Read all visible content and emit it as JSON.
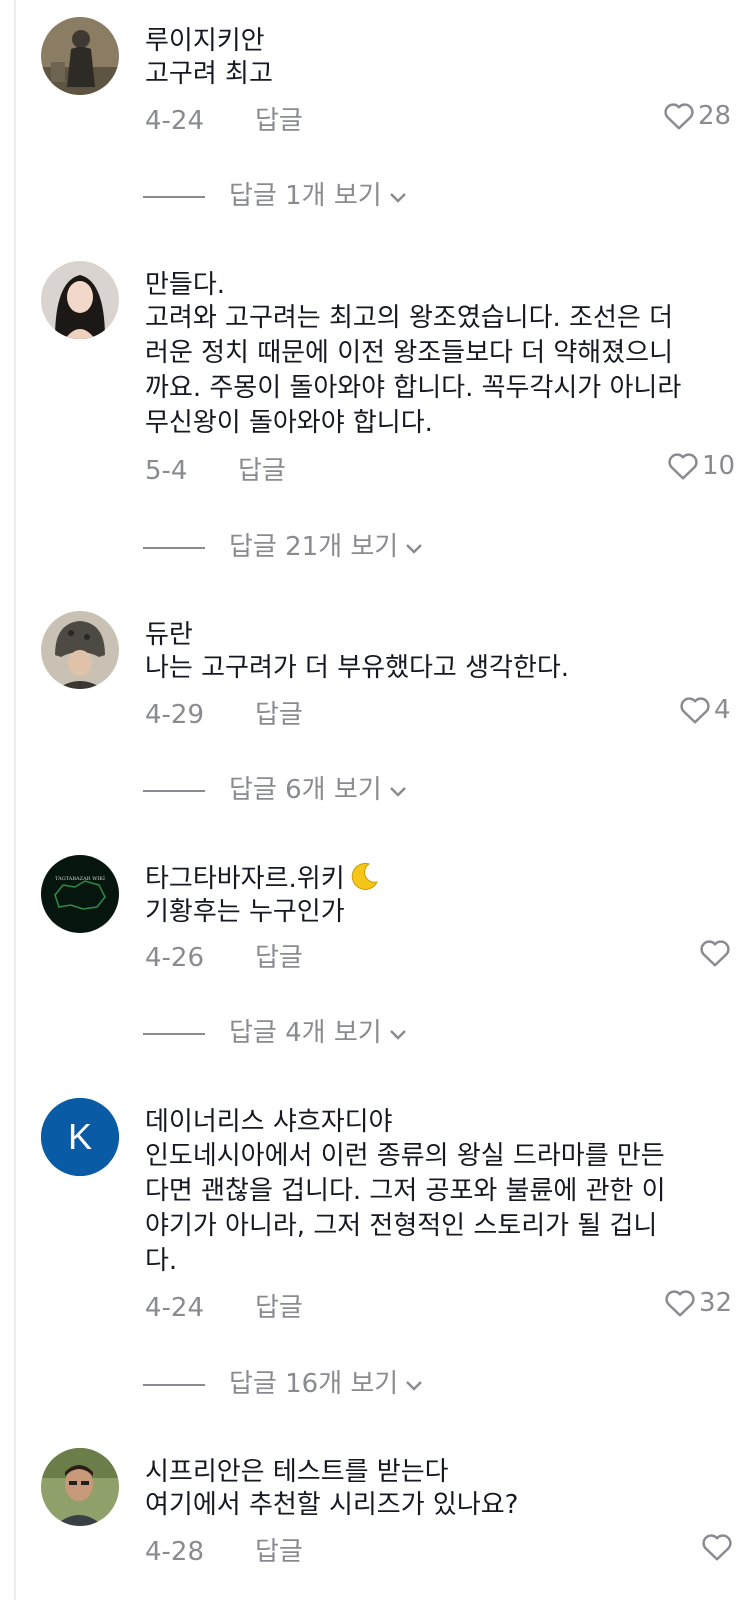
{
  "comments": [
    {
      "username": "루이지키안",
      "text": "고구려 최고",
      "date": "4-24",
      "reply_label": "답글",
      "likes": "28",
      "view_replies": "답글 1개 보기",
      "avatar_icon": "person-silhouette-avatar"
    },
    {
      "username": "만들다.",
      "text": "고려와 고구려는 최고의 왕조였습니다. 조선은 더\n러운 정치 때문에 이전 왕조들보다 더 약해졌으니\n까요. 주몽이 돌아와야 합니다. 꼭두각시가 아니라\n무신왕이 돌아와야 합니다.",
      "date": "5-4",
      "reply_label": "답글",
      "likes": "10",
      "view_replies": "답글 21개 보기",
      "avatar_icon": "woman-portrait-avatar"
    },
    {
      "username": "듀란",
      "text": "나는 고구려가 더 부유했다고 생각한다.",
      "date": "4-29",
      "reply_label": "답글",
      "likes": "4",
      "view_replies": "답글 6개 보기",
      "avatar_icon": "helmet-portrait-avatar"
    },
    {
      "username": "타그타바자르.위키",
      "text": "기황후는 누구인가",
      "date": "4-26",
      "reply_label": "답글",
      "likes": "",
      "view_replies": "답글 4개 보기",
      "avatar_icon": "map-logo-avatar",
      "avatar_text": "TAGTABAZAR WIKI"
    },
    {
      "username": "데이너리스 샤흐자디야",
      "text": "인도네시아에서 이런 종류의 왕실 드라마를 만든\n다면 괜찮을 겁니다. 그저 공포와 불륜에 관한 이\n야기가 아니라, 그저 전형적인 스토리가 될 겁니\n다.",
      "date": "4-24",
      "reply_label": "답글",
      "likes": "32",
      "view_replies": "답글 16개 보기",
      "avatar_icon": "letter-avatar",
      "avatar_letter": "K"
    },
    {
      "username": "시프리안은 테스트를 받는다",
      "text": "여기에서 추천할 시리즈가 있나요?",
      "date": "4-28",
      "reply_label": "답글",
      "likes": "",
      "view_replies": "",
      "avatar_icon": "man-portrait-avatar"
    }
  ],
  "colors": {
    "primary_text": "#161823",
    "secondary_text": "#8a8b91",
    "letter_avatar_bg": "#0a5ba6"
  }
}
